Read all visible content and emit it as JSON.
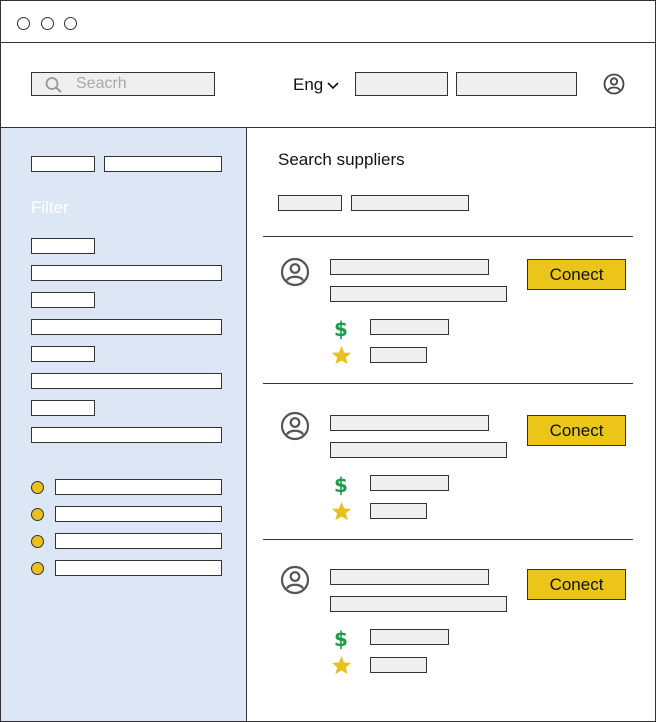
{
  "window": {
    "controls": [
      "close",
      "minimize",
      "maximize"
    ]
  },
  "header": {
    "search": {
      "placeholder": "Seacrh",
      "icon": "search-icon"
    },
    "language": {
      "label": "Eng",
      "icon": "chevron-down-icon"
    },
    "user_icon": "user-icon"
  },
  "sidebar": {
    "filter_label": "Filter"
  },
  "main": {
    "title": "Search suppliers",
    "suppliers": [
      {
        "connect_label": "Conect",
        "avatar": "user-icon",
        "price_icon": "dollar-icon",
        "rating_icon": "star-icon"
      },
      {
        "connect_label": "Conect",
        "avatar": "user-icon",
        "price_icon": "dollar-icon",
        "rating_icon": "star-icon"
      },
      {
        "connect_label": "Conect",
        "avatar": "user-icon",
        "price_icon": "dollar-icon",
        "rating_icon": "star-icon"
      }
    ]
  },
  "colors": {
    "sidebar_bg": "#dce6f4",
    "accent_yellow": "#ecc51a",
    "dollar_green": "#1e9a4a",
    "placeholder_gray": "#efefef",
    "border": "#333333"
  }
}
